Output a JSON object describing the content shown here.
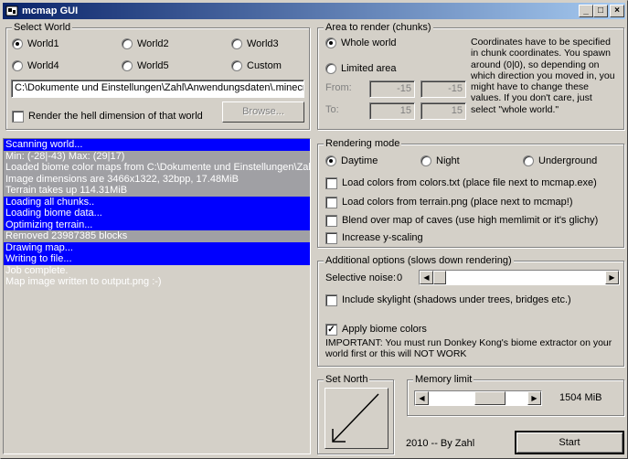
{
  "window": {
    "title": "mcmap GUI",
    "minimize": "_",
    "maximize": "□",
    "close": "×"
  },
  "select_world": {
    "legend": "Select World",
    "options": [
      "World1",
      "World2",
      "World3",
      "World4",
      "World5",
      "Custom"
    ],
    "selected": "World1",
    "path": "C:\\Dokumente und Einstellungen\\Zahl\\Anwendungsdaten\\.minecraft",
    "hell_label": "Render the hell dimension of that world",
    "browse_label": "Browse..."
  },
  "area": {
    "legend": "Area to render (chunks)",
    "whole_label": "Whole world",
    "limited_label": "Limited area",
    "from_label": "From:",
    "to_label": "To:",
    "from_x": "-15",
    "from_z": "-15",
    "to_x": "15",
    "to_z": "15",
    "note": "Coordinates have to be specified in chunk coordinates. You spawn around (0|0), so depending on which direction you moved in, you might have to change these values. If you don't care, just select \"whole world.\""
  },
  "log": {
    "lines": [
      {
        "text": "Scanning world...",
        "style": "hi"
      },
      {
        "text": "Min: (-28|-43) Max: (29|17)",
        "style": "lo"
      },
      {
        "text": "Loaded biome color maps from C:\\Dokumente und Einstellungen\\Zahl\\Anwendungsdaten",
        "style": "lo"
      },
      {
        "text": "Image dimensions are 3466x1322, 32bpp, 17.48MiB",
        "style": "lo"
      },
      {
        "text": "Terrain takes up 114.31MiB",
        "style": "lo"
      },
      {
        "text": "Loading all chunks..",
        "style": "hi"
      },
      {
        "text": "Loading biome data...",
        "style": "hi"
      },
      {
        "text": "Optimizing terrain...",
        "style": "hi"
      },
      {
        "text": "Removed 23987385 blocks",
        "style": "lo"
      },
      {
        "text": "Drawing map...",
        "style": "hi"
      },
      {
        "text": "Writing to file...",
        "style": "hi"
      },
      {
        "text": "Job complete.",
        "style": "none"
      },
      {
        "text": "Map image written to output.png :-)",
        "style": "none"
      }
    ]
  },
  "rendering": {
    "legend": "Rendering mode",
    "modes": [
      "Daytime",
      "Night",
      "Underground"
    ],
    "selected": "Daytime",
    "options": [
      {
        "label": "Load colors from colors.txt (place file next to mcmap.exe)",
        "checked": false
      },
      {
        "label": "Load colors from terrain.png (place next to mcmap!)",
        "checked": false
      },
      {
        "label": "Blend over map of caves (use high memlimit or it's glichy)",
        "checked": false
      },
      {
        "label": "Increase y-scaling",
        "checked": false
      }
    ]
  },
  "additional": {
    "legend": "Additional options (slows down rendering)",
    "noise_label": "Selective noise:",
    "noise_value": "0",
    "noise_fraction": 0.0,
    "skylight_label": "Include skylight (shadows under trees, bridges etc.)",
    "skylight_checked": false,
    "biome_label": "Apply biome colors",
    "biome_checked": true,
    "biome_note": "IMPORTANT: You must run Donkey Kong's biome extractor on your world first or this will NOT WORK"
  },
  "set_north": {
    "legend": "Set North"
  },
  "memory": {
    "legend": "Memory limit",
    "value": "1504 MiB",
    "fraction": 0.67
  },
  "footer": {
    "credit": "2010 -- By Zahl",
    "start_label": "Start"
  },
  "icons": {
    "app": "app-icon",
    "arrow": "south-west-arrow-icon"
  }
}
